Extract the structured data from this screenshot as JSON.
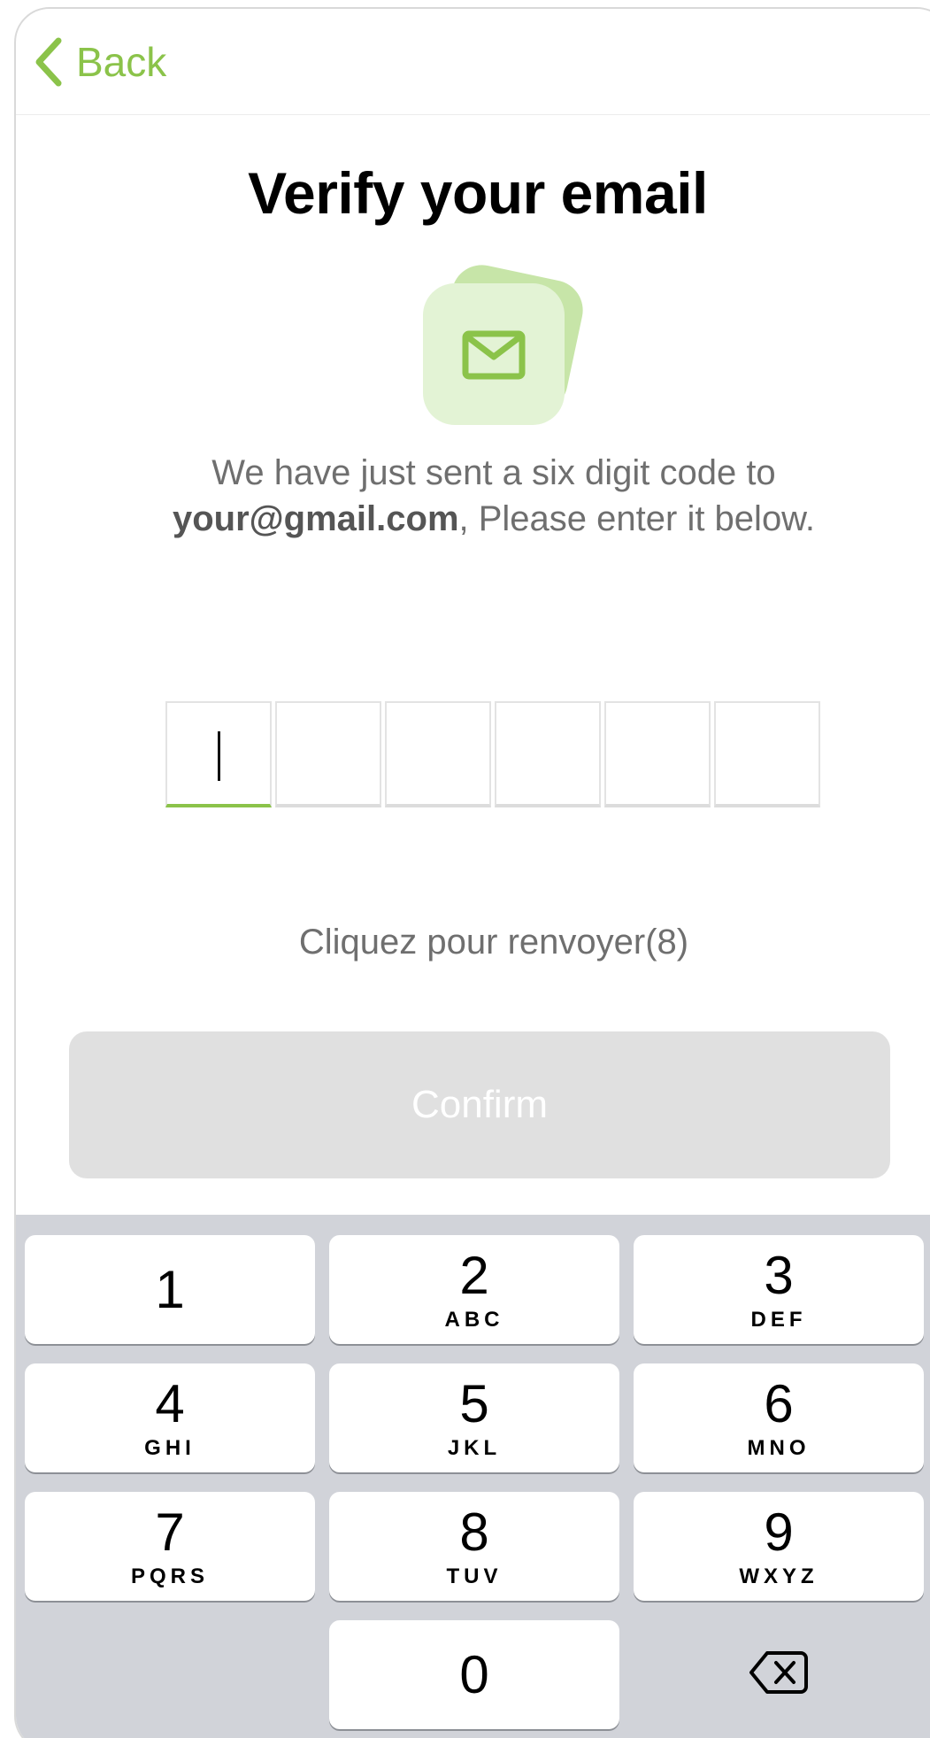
{
  "nav": {
    "back_label": "Back"
  },
  "page": {
    "title": "Verify your email",
    "description_line1": "We have just sent a six digit code to",
    "email": "your@gmail.com",
    "description_line2_suffix": ", Please enter it below.",
    "resend_label": "Cliquez pour renvoyer(8)",
    "confirm_label": "Confirm"
  },
  "otp": {
    "length": 6,
    "active_index": 0
  },
  "colors": {
    "accent": "#8bc34a",
    "button_disabled": "#e0e0e0",
    "keypad_bg": "#d1d3d9"
  },
  "keypad": {
    "keys": [
      {
        "num": "1",
        "letters": ""
      },
      {
        "num": "2",
        "letters": "ABC"
      },
      {
        "num": "3",
        "letters": "DEF"
      },
      {
        "num": "4",
        "letters": "GHI"
      },
      {
        "num": "5",
        "letters": "JKL"
      },
      {
        "num": "6",
        "letters": "MNO"
      },
      {
        "num": "7",
        "letters": "PQRS"
      },
      {
        "num": "8",
        "letters": "TUV"
      },
      {
        "num": "9",
        "letters": "WXYZ"
      },
      {
        "num": "0",
        "letters": ""
      }
    ],
    "delete_icon": "backspace-icon"
  }
}
